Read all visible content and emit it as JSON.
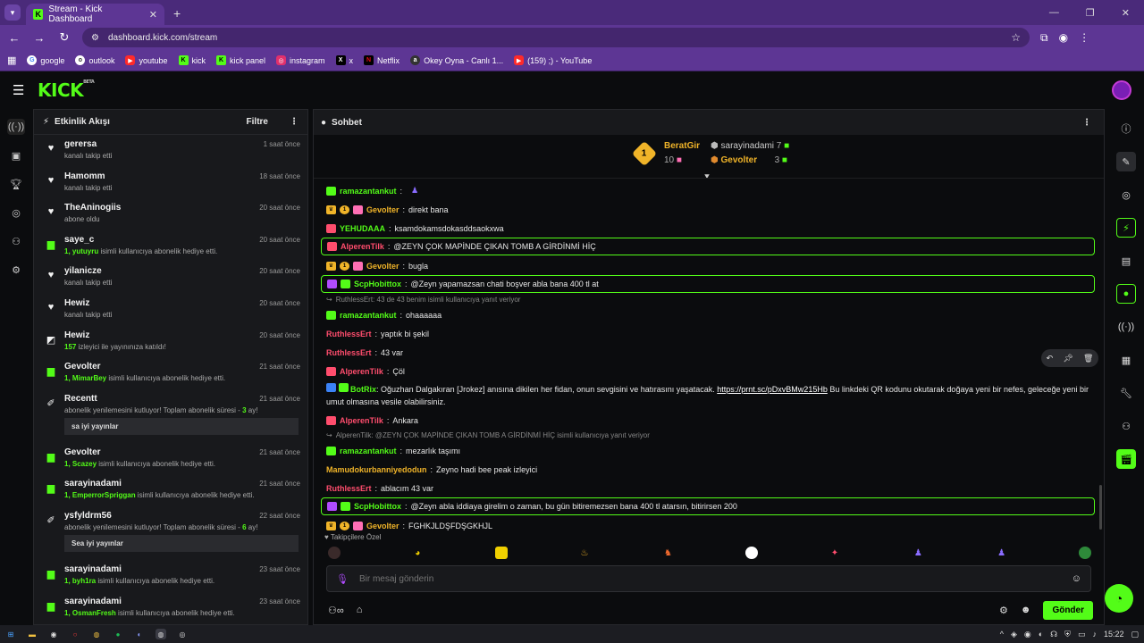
{
  "browser": {
    "tab_title": "Stream - Kick Dashboard",
    "url": "dashboard.kick.com/stream",
    "bookmarks": [
      {
        "label": "google",
        "icon": "G",
        "color": "#ffffff"
      },
      {
        "label": "outlook",
        "icon": "o",
        "color": "#ffffff"
      },
      {
        "label": "youtube",
        "icon": "▶",
        "color": "#ff2a2a"
      },
      {
        "label": "kick",
        "icon": "K",
        "color": "#53fc18"
      },
      {
        "label": "kick panel",
        "icon": "K",
        "color": "#53fc18"
      },
      {
        "label": "instagram",
        "icon": "◎",
        "color": "#e1306c"
      },
      {
        "label": "x",
        "icon": "X",
        "color": "#000000"
      },
      {
        "label": "Netflix",
        "icon": "N",
        "color": "#e50914"
      },
      {
        "label": "Okey Oyna - Canlı 1...",
        "icon": "a",
        "color": "#333333"
      },
      {
        "label": "(159) ;) - YouTube",
        "icon": "▶",
        "color": "#ff2a2a"
      }
    ]
  },
  "kick": {
    "logo": "KICK",
    "logo_sup": "BETA"
  },
  "activity": {
    "title": "Etkinlik Akışı",
    "filter": "Filtre",
    "events": [
      {
        "icon": "heart",
        "name": "gerersa",
        "desc": "kanalı takip etti",
        "time": "1 saat önce"
      },
      {
        "icon": "heart",
        "name": "Hamomm",
        "desc": "kanalı takip etti",
        "time": "18 saat önce"
      },
      {
        "icon": "heart",
        "name": "TheAninogiis",
        "desc": "abone oldu",
        "time": "20 saat önce"
      },
      {
        "icon": "gift",
        "name": "saye_c",
        "hl": "1, yutuyru",
        "desc": " isimli kullanıcıya abonelik hediye etti.",
        "time": "20 saat önce"
      },
      {
        "icon": "heart",
        "name": "yilanicze",
        "desc": "kanalı takip etti",
        "time": "20 saat önce"
      },
      {
        "icon": "heart",
        "name": "Hewiz",
        "desc": "kanalı takip etti",
        "time": "20 saat önce"
      },
      {
        "icon": "raid",
        "name": "Hewiz",
        "hl": "157",
        "desc": " izleyici ile yayınınıza katıldı!",
        "time": "20 saat önce"
      },
      {
        "icon": "gift",
        "name": "Gevolter",
        "hl": "1, MimarBey",
        "desc": " isimli kullanıcıya abonelik hediye etti.",
        "time": "21 saat önce"
      },
      {
        "icon": "resub",
        "name": "Recentt",
        "desc": "abonelik yenilemesini kutluyor! Toplam abonelik süresi - ",
        "hl2": "3",
        "desc2": " ay!",
        "quote": "sa iyi yayınlar",
        "time": "21 saat önce"
      },
      {
        "icon": "gift",
        "name": "Gevolter",
        "hl": "1, Scazey",
        "desc": " isimli kullanıcıya abonelik hediye etti.",
        "time": "21 saat önce"
      },
      {
        "icon": "gift",
        "name": "sarayinadami",
        "hl": "1, EmperrorSpriggan",
        "desc": " isimli kullanıcıya abonelik hediye etti.",
        "time": "21 saat önce"
      },
      {
        "icon": "resub",
        "name": "ysfyldrm56",
        "desc": "abonelik yenilemesini kutluyor! Toplam abonelik süresi - ",
        "hl2": "6",
        "desc2": " ay!",
        "quote": "Sea iyi yayınlar",
        "time": "22 saat önce"
      },
      {
        "icon": "gift",
        "name": "sarayinadami",
        "hl": "1, byh1ra",
        "desc": " isimli kullanıcıya abonelik hediye etti.",
        "time": "23 saat önce"
      },
      {
        "icon": "gift",
        "name": "sarayinadami",
        "hl": "1, OsmanFresh",
        "desc": " isimli kullanıcıya abonelik hediye etti.",
        "time": "23 saat önce"
      }
    ]
  },
  "chat": {
    "title": "Sohbet",
    "leaderboard": {
      "first": {
        "name": "BeratGir",
        "count": "10"
      },
      "second": {
        "name": "sarayinadami",
        "count": "7"
      },
      "third": {
        "name": "Gevolter",
        "count": "3"
      }
    },
    "messages": [
      {
        "user": "ramazantankut",
        "color": "#53fc18",
        "badges": [
          "green"
        ],
        "text": "",
        "emote": true
      },
      {
        "user": "Gevolter",
        "color": "#f0b429",
        "badges": [
          "crown",
          "one",
          "gift"
        ],
        "text": "direkt bana"
      },
      {
        "user": "YEHUDAAA",
        "color": "#53fc18",
        "badges": [
          "red"
        ],
        "text": "ksamdokamsdokasddsaokxwa"
      },
      {
        "user": "AlperenTilk",
        "color": "#ff4d6d",
        "badges": [
          "red"
        ],
        "text": "@ZEYN ÇOK MAPİNDE ÇIKAN TOMB A GİRDİNMİ HİÇ",
        "highlight": true
      },
      {
        "user": "Gevolter",
        "color": "#f0b429",
        "badges": [
          "crown",
          "one",
          "gift"
        ],
        "text": "bugla"
      },
      {
        "user": "ScpHobittox",
        "color": "#53fc18",
        "badges": [
          "vio",
          "green"
        ],
        "text": "@Zeyn yapamazsan chati boşver abla bana 400 tl at",
        "highlight": true
      },
      {
        "reply": "RuthlessErt: 43 de 43 benim isimli kullanıcıya yanıt veriyor"
      },
      {
        "user": "ramazantankut",
        "color": "#53fc18",
        "badges": [
          "green"
        ],
        "text": "ohaaaaaa"
      },
      {
        "user": "RuthlessErt",
        "color": "#ff4d6d",
        "badges": [],
        "text": "yaptık bi şekil"
      },
      {
        "user": "RuthlessErt",
        "color": "#ff4d6d",
        "badges": [],
        "text": "43 var"
      },
      {
        "user": "AlperenTilk",
        "color": "#ff4d6d",
        "badges": [
          "red"
        ],
        "text": "Çöl"
      },
      {
        "user": "BotRix",
        "color": "#53fc18",
        "badges": [
          "bot",
          "green"
        ],
        "text": "Oğuzhan Dalgakıran [Jrokez] anısına dikilen her fidan, onun sevgisini ve hatırasını yaşatacak.",
        "link": "https://prnt.sc/pDxvBMw215Hb",
        "text2": "Bu linkdeki QR kodunu okutarak doğaya yeni bir nefes, geleceğe yeni bir umut olmasına vesile olabilirsiniz.",
        "wrap": true
      },
      {
        "user": "AlperenTilk",
        "color": "#ff4d6d",
        "badges": [
          "red"
        ],
        "text": "Ankara"
      },
      {
        "reply": "AlperenTilk: @ZEYN ÇOK MAPİNDE ÇIKAN TOMB A GİRDİNMİ HİÇ isimli kullanıcıya yanıt veriyor"
      },
      {
        "user": "ramazantankut",
        "color": "#53fc18",
        "badges": [
          "green"
        ],
        "text": "mezarlık taşımı"
      },
      {
        "user": "Mamudokurbanniyedodun",
        "color": "#f0b429",
        "badges": [],
        "text": "Zeyno hadi bee peak izleyici"
      },
      {
        "user": "RuthlessErt",
        "color": "#ff4d6d",
        "badges": [],
        "text": "ablacım 43 var"
      },
      {
        "user": "ScpHobittox",
        "color": "#53fc18",
        "badges": [
          "vio",
          "green"
        ],
        "text": "@Zeyn abla iddiaya girelim o zaman, bu gün bitiremezsen bana 400 tl atarsın, bitirirsen 200",
        "highlight": true
      },
      {
        "user": "Gevolter",
        "color": "#f0b429",
        "badges": [
          "crown",
          "one",
          "gift"
        ],
        "text": "FGHKJLDŞFDŞGKHJL"
      }
    ],
    "emotes_label": "Takipçilere Özel",
    "input_placeholder": "Bir mesaj gönderin",
    "send_label": "Gönder"
  },
  "taskbar": {
    "time": "15:22"
  }
}
